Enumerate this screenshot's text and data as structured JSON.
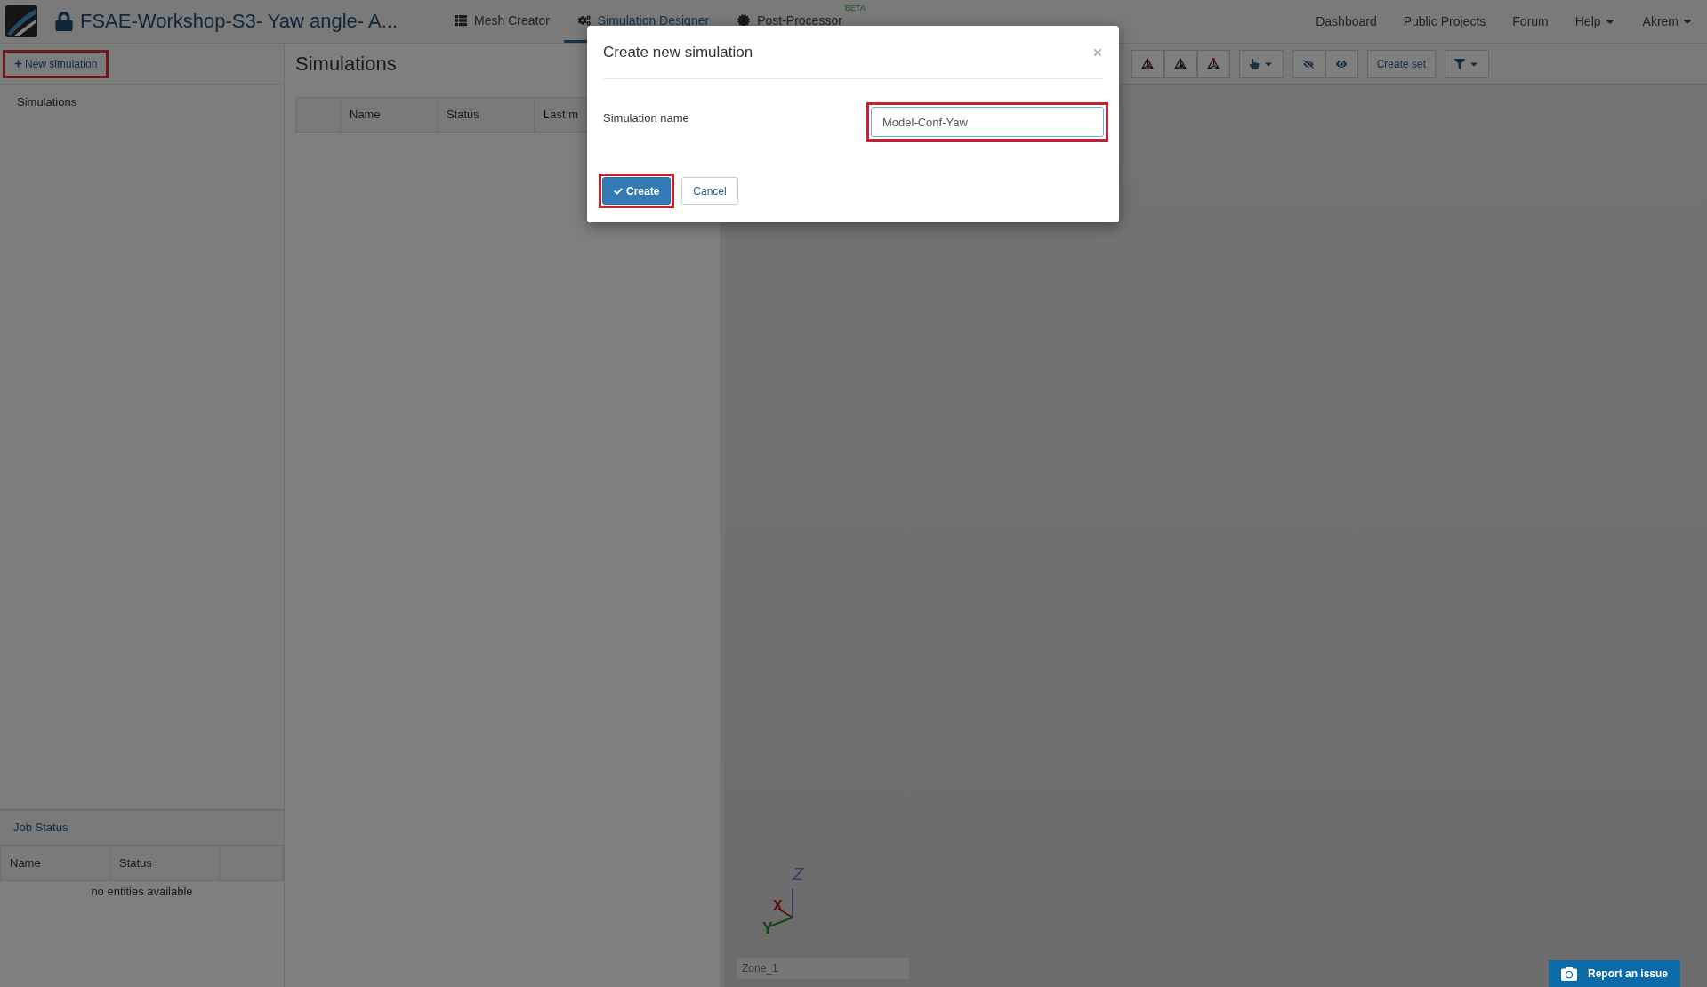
{
  "header": {
    "project_title": "FSAE-Workshop-S3- Yaw angle- A...",
    "tabs": [
      {
        "label": "Mesh Creator",
        "selected": false
      },
      {
        "label": "Simulation Designer",
        "selected": true
      },
      {
        "label": "Post-Processor",
        "selected": false,
        "badge": "BETA"
      }
    ],
    "menu": [
      {
        "label": "Dashboard",
        "dropdown": false
      },
      {
        "label": "Public Projects",
        "dropdown": false
      },
      {
        "label": "Forum",
        "dropdown": false
      },
      {
        "label": "Help",
        "dropdown": true
      },
      {
        "label": "Akrem",
        "dropdown": true
      }
    ]
  },
  "sidebar": {
    "new_button": {
      "label": "New simulation",
      "highlighted": true
    },
    "tree": [
      {
        "label": "Simulations"
      }
    ],
    "job_status": {
      "title": "Job Status",
      "columns": [
        "Name",
        "Status",
        ""
      ],
      "empty_text": "no entities available"
    }
  },
  "simulations_panel": {
    "title": "Simulations",
    "columns": [
      "",
      "Name",
      "Status",
      "Last m"
    ]
  },
  "viewer": {
    "toolbar": {
      "create_set": "Create set"
    },
    "axis_labels": [
      "Z",
      "X",
      "Y"
    ],
    "zone_field": {
      "placeholder": "Zone_1"
    }
  },
  "dialog": {
    "title": "Create new simulation",
    "field_label": "Simulation name",
    "field_value": "Model-Conf-Yaw",
    "field_highlighted": true,
    "buttons": [
      {
        "label": "Create",
        "kind": "primary",
        "highlighted": true
      },
      {
        "label": "Cancel",
        "kind": "default",
        "highlighted": false
      }
    ]
  },
  "report_button": "Report an issue"
}
